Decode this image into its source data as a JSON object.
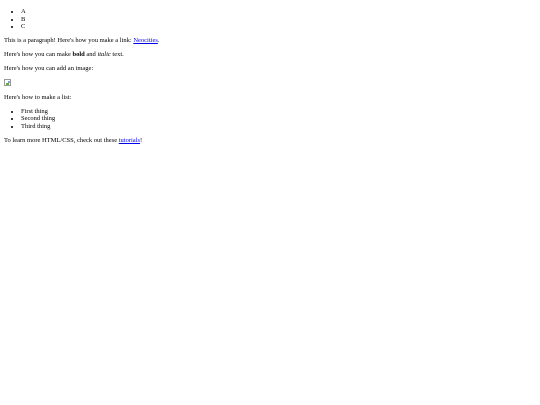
{
  "top_list": [
    "A",
    "B",
    "C"
  ],
  "para_link": {
    "before": "This is a paragraph! Here's how you make a link: ",
    "link_text": "Neocities",
    "after": "."
  },
  "para_format": {
    "before": "Here's how you can make ",
    "bold": "bold",
    "middle": " and ",
    "italic": "italic",
    "after": " text."
  },
  "para_image": "Here's how you can add an image:",
  "image_icon": "broken-image-icon",
  "para_list": "Here's how to make a list:",
  "things_list": [
    "First thing",
    "Second thing",
    "Third thing"
  ],
  "para_learn": {
    "before": "To learn more HTML/CSS, check out these ",
    "link_text": "tutorials",
    "after": "!"
  },
  "colors": {
    "link": "#0000ee",
    "text": "#000000",
    "background": "#ffffff"
  }
}
